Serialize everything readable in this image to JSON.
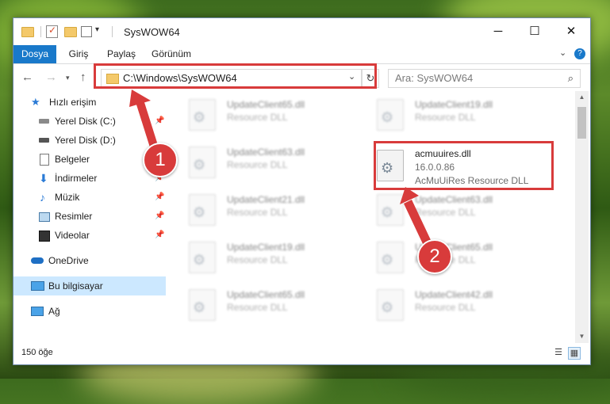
{
  "window": {
    "title": "SysWOW64",
    "buttons": {
      "minimize": "─",
      "maximize": "☐",
      "close": "✕"
    }
  },
  "ribbon": {
    "tabs": [
      "Dosya",
      "Giriş",
      "Paylaş",
      "Görünüm"
    ],
    "expand": "⌄",
    "help": "?"
  },
  "address": {
    "path": "C:\\Windows\\SysWOW64",
    "search_placeholder": "Ara: SysWOW64",
    "icons": [
      "back-arrow-icon",
      "forward-arrow-icon",
      "recent-dropdown-icon",
      "up-arrow-icon",
      "refresh-icon",
      "search-icon"
    ]
  },
  "sidebar": {
    "items": [
      {
        "label": "Hızlı erişim",
        "icon": "star-icon",
        "pinned": false
      },
      {
        "label": "Yerel Disk (C:)",
        "icon": "drive-icon",
        "pinned": true
      },
      {
        "label": "Yerel Disk (D:)",
        "icon": "drive-icon",
        "pinned": false
      },
      {
        "label": "Belgeler",
        "icon": "documents-icon",
        "pinned": true
      },
      {
        "label": "İndirmeler",
        "icon": "download-icon",
        "pinned": true
      },
      {
        "label": "Müzik",
        "icon": "music-icon",
        "pinned": true
      },
      {
        "label": "Resimler",
        "icon": "pictures-icon",
        "pinned": true
      },
      {
        "label": "Videolar",
        "icon": "videos-icon",
        "pinned": true
      },
      {
        "label": "OneDrive",
        "icon": "cloud-icon",
        "pinned": false
      },
      {
        "label": "Bu bilgisayar",
        "icon": "computer-icon",
        "pinned": false,
        "selected": true
      },
      {
        "label": "Ağ",
        "icon": "network-icon",
        "pinned": false
      }
    ]
  },
  "files": [
    {
      "name": "UpdateClient65.dll",
      "desc": "Resource DLL"
    },
    {
      "name": "UpdateClient19.dll",
      "desc": "Resource DLL"
    },
    {
      "name": "UpdateClient63.dll",
      "desc": "Resource DLL"
    },
    {
      "name": "acmuuires.dll",
      "version": "16.0.0.86",
      "desc": "AcMuUiRes Resource DLL",
      "highlighted": true
    },
    {
      "name": "UpdateClient21.dll",
      "desc": "Resource DLL"
    },
    {
      "name": "UpdateClient63.dll",
      "desc": "Resource DLL"
    },
    {
      "name": "UpdateClient19.dll",
      "desc": "Resource DLL"
    },
    {
      "name": "UpdateClient65.dll",
      "desc": "Resource DLL"
    },
    {
      "name": "UpdateClient65.dll",
      "desc": "Resource DLL"
    },
    {
      "name": "UpdateClient42.dll",
      "desc": "Resource DLL"
    }
  ],
  "status": {
    "item_count": "150 öğe"
  },
  "annotations": {
    "colors": {
      "highlight": "#d83b3b"
    },
    "badges": [
      "1",
      "2"
    ]
  }
}
